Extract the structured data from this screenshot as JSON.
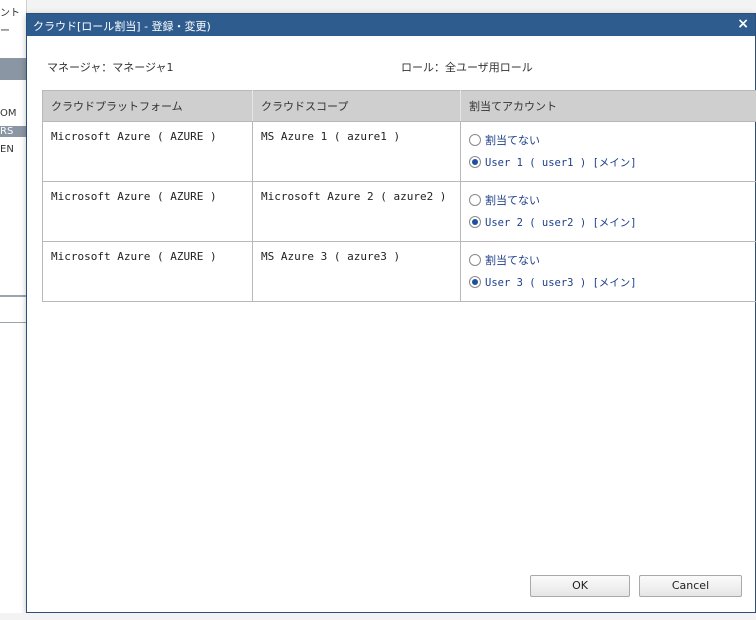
{
  "background": {
    "frag1": "ント",
    "frag2": "ー",
    "frag3": "OM",
    "frag4": "RS",
    "frag5": "EN"
  },
  "dialog": {
    "title": "クラウド[ロール割当] - 登録・変更)",
    "close": "×",
    "manager_label": "マネージャ：マネージャ1",
    "role_label": "ロール：全ユーザ用ロール",
    "columns": [
      "クラウドプラットフォーム",
      "クラウドスコープ",
      "割当てアカウント"
    ],
    "rows": [
      {
        "platform": "Microsoft Azure ( AZURE )",
        "scope": "MS Azure 1 ( azure1 )",
        "options": [
          {
            "label": "割当てない",
            "checked": false
          },
          {
            "label": "User 1 ( user1 ) [メイン]",
            "checked": true
          }
        ]
      },
      {
        "platform": "Microsoft Azure ( AZURE )",
        "scope": "Microsoft Azure 2 ( azure2 )",
        "options": [
          {
            "label": "割当てない",
            "checked": false
          },
          {
            "label": "User 2 ( user2 ) [メイン]",
            "checked": true
          }
        ]
      },
      {
        "platform": "Microsoft Azure ( AZURE )",
        "scope": "MS Azure 3 ( azure3 )",
        "options": [
          {
            "label": "割当てない",
            "checked": false
          },
          {
            "label": "User 3 ( user3 ) [メイン]",
            "checked": true
          }
        ]
      }
    ],
    "ok_label": "OK",
    "cancel_label": "Cancel"
  },
  "colors": {
    "titlebar": "#2e5c8f",
    "header_bg": "#cfcfcf",
    "radio_accent": "#1f4fa0"
  }
}
